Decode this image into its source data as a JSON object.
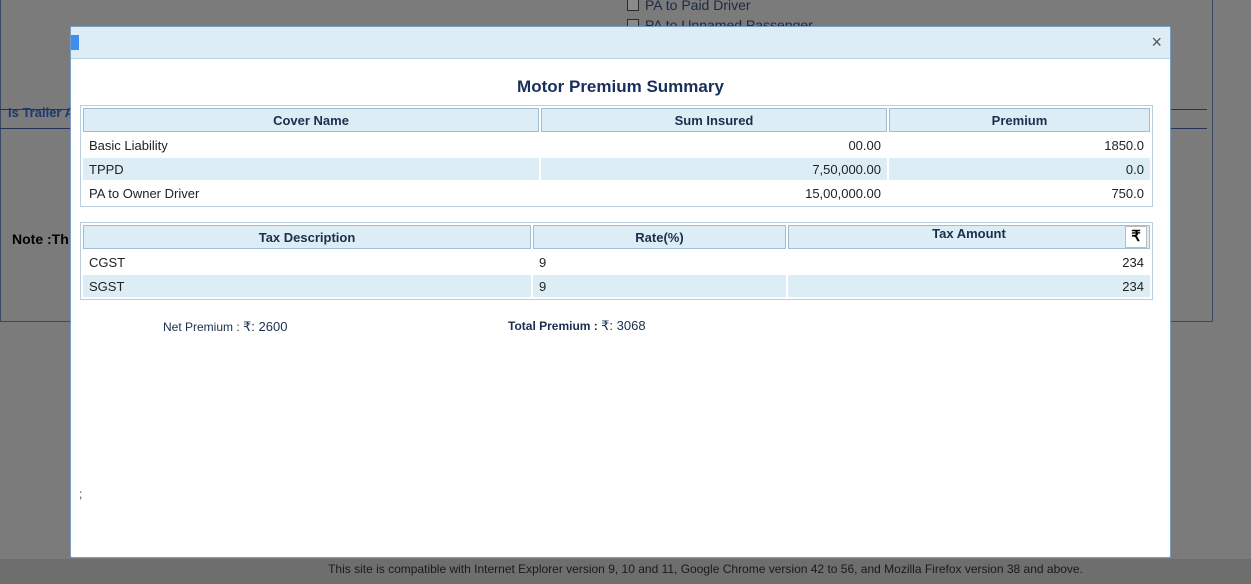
{
  "background": {
    "checkbox_1": "PA to Paid Driver",
    "checkbox_2": "PA to Unnamed Passenger",
    "trailer_label": "Is Trailer A",
    "note_label": "Note :Th",
    "footer": "This site is compatible with Internet Explorer version 9, 10 and 11, Google Chrome version 42 to 56, and Mozilla Firefox version 38 and above."
  },
  "modal": {
    "close": "×",
    "title": "Motor Premium Summary",
    "cover_table": {
      "headers": [
        "Cover Name",
        "Sum Insured",
        "Premium"
      ],
      "rows": [
        [
          "Basic Liability",
          "00.00",
          "1850.0"
        ],
        [
          "TPPD",
          "7,50,000.00",
          "0.0"
        ],
        [
          "PA to Owner Driver",
          "15,00,000.00",
          "750.0"
        ]
      ]
    },
    "tax_table": {
      "headers": [
        "Tax Description",
        "Rate(%)",
        "Tax Amount"
      ],
      "currency_symbol": "₹",
      "rows": [
        [
          "CGST",
          "9",
          "234"
        ],
        [
          "SGST",
          "9",
          "234"
        ]
      ]
    },
    "net_premium_label": "Net Premium :",
    "net_premium_value": "₹: 2600",
    "total_premium_label": "Total Premium :",
    "total_premium_value": "₹: 3068",
    "trailing_text": ";"
  },
  "colors": {
    "header_bg": "#dcedf5",
    "title": "#1a2f5e",
    "overlay": "#7b7b7b"
  }
}
